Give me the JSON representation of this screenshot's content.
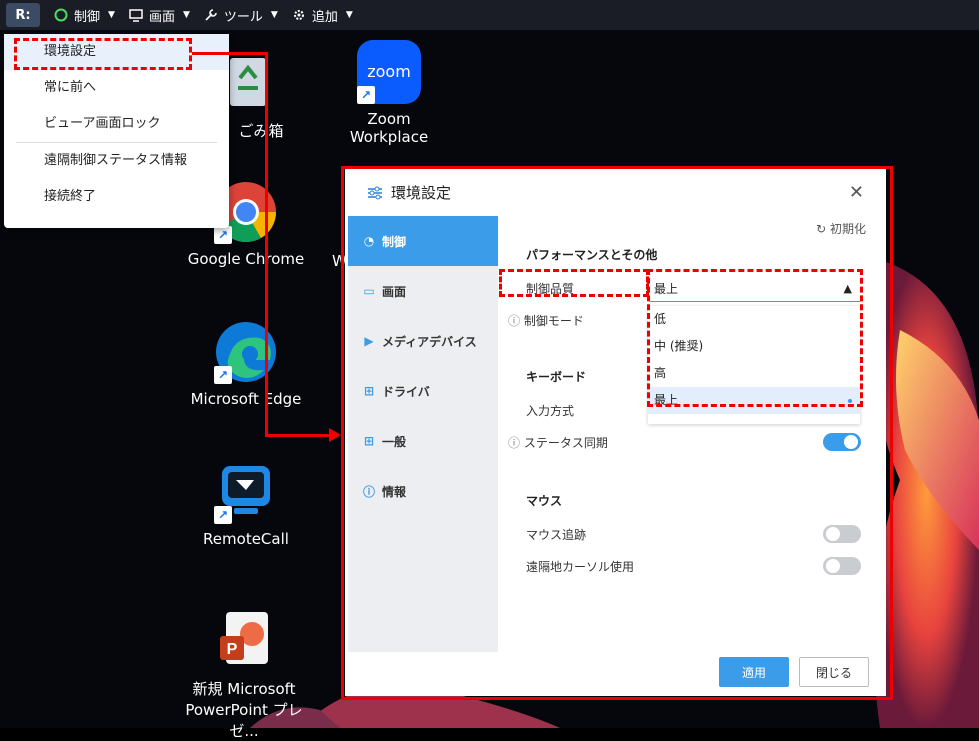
{
  "toolbar": {
    "logo": "R:",
    "menus": [
      {
        "label": "制御",
        "icon": "control-icon"
      },
      {
        "label": "画面",
        "icon": "monitor-icon"
      },
      {
        "label": "ツール",
        "icon": "wrench-icon"
      },
      {
        "label": "追加",
        "icon": "gear-icon"
      }
    ]
  },
  "dropdown": {
    "items": [
      {
        "label": "環境設定",
        "selected": true
      },
      {
        "label": "常に前へ"
      },
      {
        "label": "ビューア画面ロック"
      },
      {
        "label": "遠隔制御ステータス情報"
      },
      {
        "label": "接続終了"
      }
    ]
  },
  "desktop_icons": [
    {
      "label": "ごみ箱"
    },
    {
      "label": "Zoom Workplace",
      "logo_text": "zoom"
    },
    {
      "label": "Google Chrome"
    },
    {
      "label": "Microsoft Edge"
    },
    {
      "label": "RemoteCall"
    },
    {
      "label_line1": "新規 Microsoft",
      "label_line2": "PowerPoint プレゼ..."
    },
    {
      "label": "W"
    }
  ],
  "dialog": {
    "title": "環境設定",
    "reset": "初期化",
    "sidebar": [
      {
        "label": "制御",
        "active": true
      },
      {
        "label": "画面"
      },
      {
        "label": "メディアデバイス"
      },
      {
        "label": "ドライバ"
      },
      {
        "label": "一般"
      },
      {
        "label": "情報"
      }
    ],
    "section_performance": "パフォーマンスとその他",
    "control_quality_label": "制御品質",
    "control_quality_value": "最上",
    "control_mode_label": "制御モード",
    "quality_options": [
      "低",
      "中 (推奨)",
      "高",
      "最上"
    ],
    "section_keyboard": "キーボード",
    "input_method_label": "入力方式",
    "status_sync_label": "ステータス同期",
    "status_sync_on": true,
    "section_mouse": "マウス",
    "mouse_tracking_label": "マウス追跡",
    "mouse_tracking_on": false,
    "remote_cursor_label": "遠隔地カーソル使用",
    "remote_cursor_on": false,
    "apply_button": "適用",
    "close_button": "閉じる"
  },
  "colors": {
    "accent": "#3b9ce9",
    "annotation": "#e00000",
    "toolbar": "#1a1d26"
  }
}
